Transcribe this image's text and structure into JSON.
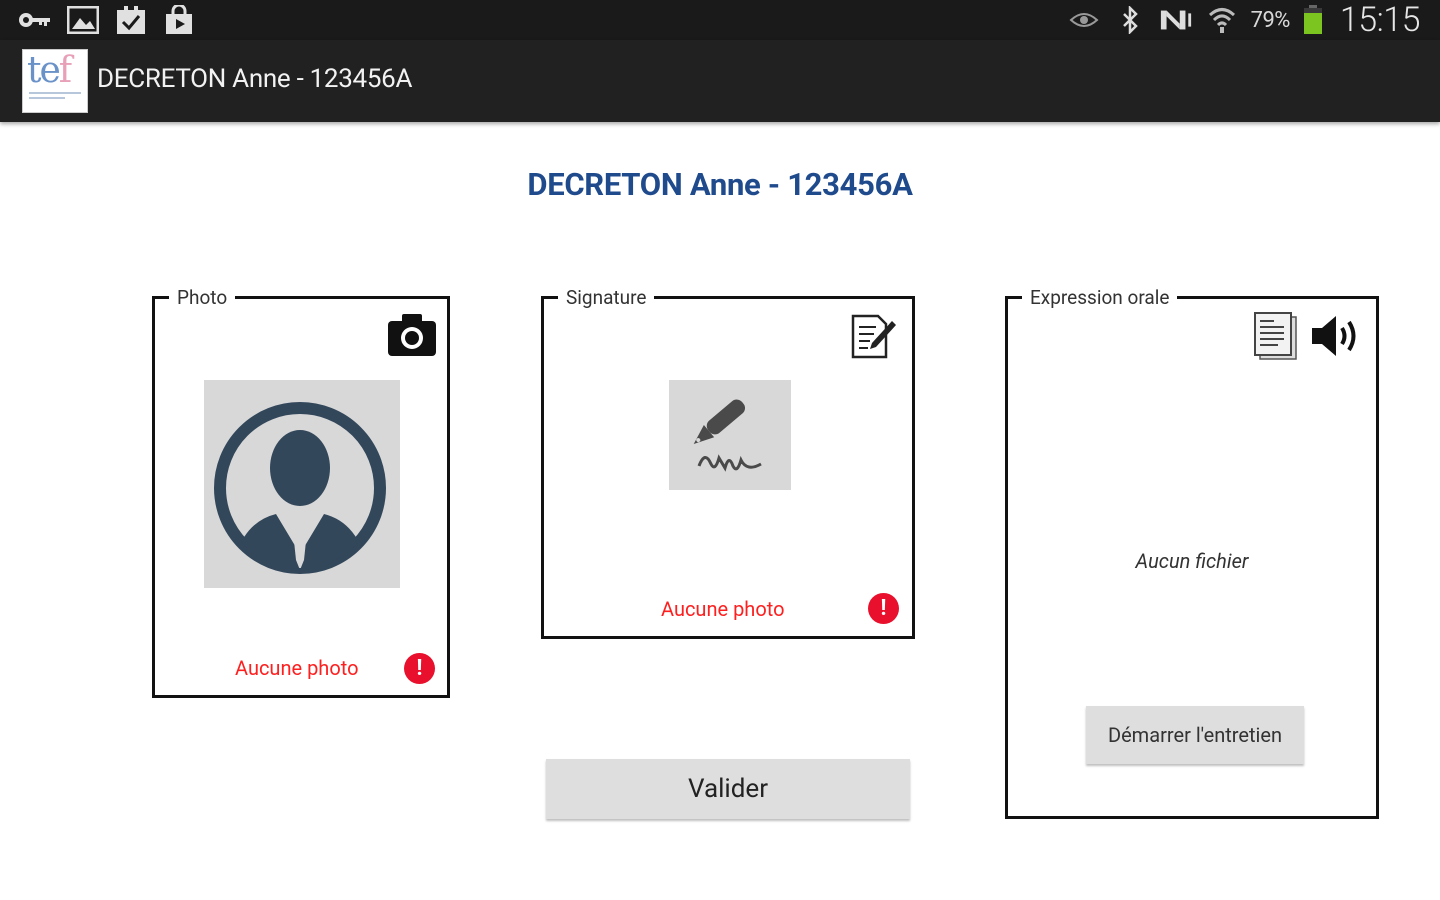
{
  "status_bar": {
    "battery_percent": "79%",
    "time": "15:15",
    "left_icons": [
      "key-icon",
      "image-icon",
      "checkbox-icon",
      "play-store-icon"
    ],
    "right_icons": [
      "eye-icon",
      "bluetooth-icon",
      "nfc-icon",
      "wifi-icon",
      "battery-icon"
    ],
    "battery_level": 0.79,
    "battery_color": "#7cc520"
  },
  "action_bar": {
    "title": "DECRETON Anne - 123456A"
  },
  "main": {
    "title": "DECRETON Anne - 123456A",
    "title_color": "#1f4a8c",
    "photo": {
      "legend": "Photo",
      "status": "Aucune photo",
      "action_icon": "camera-icon"
    },
    "signature": {
      "legend": "Signature",
      "status": "Aucune photo",
      "action_icon": "sign-document-icon"
    },
    "oral": {
      "legend": "Expression orale",
      "status": "Aucun fichier",
      "start_button": "Démarrer l'entretien",
      "icons": [
        "document-list-icon",
        "speaker-icon"
      ]
    },
    "validate_button": "Valider",
    "error_color": "#ff1f1f"
  }
}
